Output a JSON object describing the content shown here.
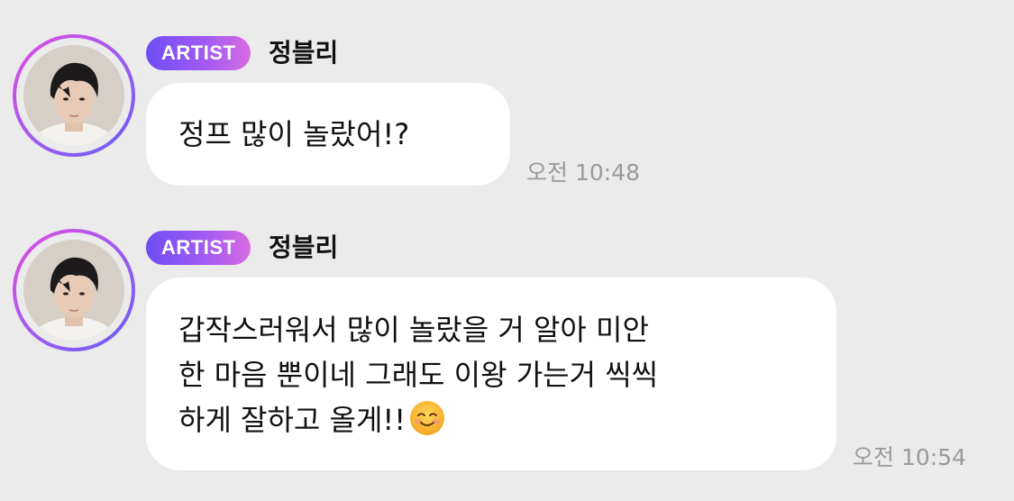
{
  "messages": [
    {
      "badge": "ARTIST",
      "sender": "정블리",
      "lines": [
        "정프 많이 놀랐어!?"
      ],
      "time": "오전 10:48"
    },
    {
      "badge": "ARTIST",
      "sender": "정블리",
      "lines": [
        "갑작스러워서 많이 놀랐을 거 알아 미안",
        "한 마음 뿐이네 그래도 이왕 가는거 씩씩",
        "하게 잘하고 올게!!"
      ],
      "emoji": "smiling-face-emoji",
      "time": "오전 10:54"
    }
  ],
  "colors": {
    "background": "#ebebeb",
    "bubble": "#ffffff",
    "badge_start": "#6e4df4",
    "badge_end": "#d86be0",
    "timestamp": "#9a9a9a"
  }
}
